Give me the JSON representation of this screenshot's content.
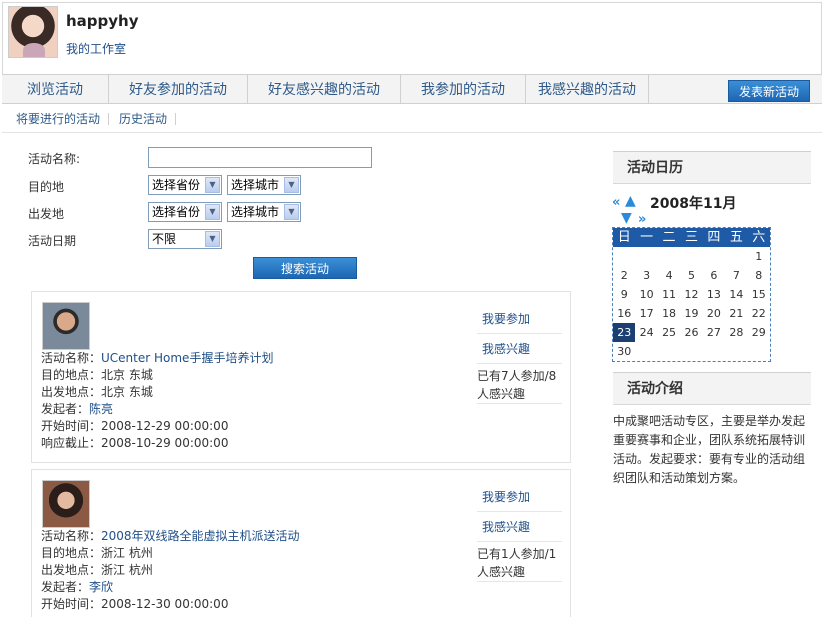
{
  "header": {
    "username": "happyhy",
    "studio_link": "我的工作室"
  },
  "tabs": [
    "浏览活动",
    "好友参加的活动",
    "好友感兴趣的活动",
    "我参加的活动",
    "我感兴趣的活动"
  ],
  "publish_button": "发表新活动",
  "subnav": [
    "将要进行的活动",
    "历史活动"
  ],
  "search_form": {
    "name_label": "活动名称:",
    "destination_label": "目的地",
    "origin_label": "出发地",
    "date_label": "活动日期",
    "province_placeholder": "选择省份",
    "city_placeholder": "选择城市",
    "date_value": "不限",
    "search_button": "搜索活动"
  },
  "activities": [
    {
      "name_prefix": "活动名称：",
      "name": "UCenter Home手握手培养计划",
      "destination": "目的地点：北京 东城",
      "origin": "出发地点：北京 东城",
      "organizer_prefix": "发起者：",
      "organizer": "陈亮",
      "start": "开始时间：2008-12-29 00:00:00",
      "deadline": "响应截止：2008-10-29 00:00:00",
      "join": "我要参加",
      "interested": "我感兴趣",
      "count_line1": "已有7人参加/8",
      "count_line2": "人感兴趣"
    },
    {
      "name_prefix": "活动名称：",
      "name": "2008年双线路全能虚拟主机派送活动",
      "destination": "目的地点：浙江 杭州",
      "origin": "出发地点：浙江 杭州",
      "organizer_prefix": "发起者：",
      "organizer": "李欣",
      "start": "开始时间：2008-12-30 00:00:00",
      "join": "我要参加",
      "interested": "我感兴趣",
      "count_line1": "已有1人参加/1",
      "count_line2": "人感兴趣"
    }
  ],
  "sidebar": {
    "calendar_title": "活动日历",
    "month": "2008年11月",
    "weekdays": [
      "日",
      "一",
      "二",
      "三",
      "四",
      "五",
      "六"
    ],
    "days": [
      "",
      "",
      "",
      "",
      "",
      "",
      "1",
      "2",
      "3",
      "4",
      "5",
      "6",
      "7",
      "8",
      "9",
      "10",
      "11",
      "12",
      "13",
      "14",
      "15",
      "16",
      "17",
      "18",
      "19",
      "20",
      "21",
      "22",
      "23",
      "24",
      "25",
      "26",
      "27",
      "28",
      "29",
      "30"
    ],
    "today": "23",
    "intro_title": "活动介绍",
    "intro_text": "中成聚吧活动专区，主要是举办发起重要赛事和企业，团队系统拓展特训活动。发起要求：要有专业的活动组织团队和活动策划方案。"
  },
  "colors": {
    "accent": "#1d66b3",
    "link": "#1f4f88",
    "calendar_header": "#1e5aa5"
  }
}
